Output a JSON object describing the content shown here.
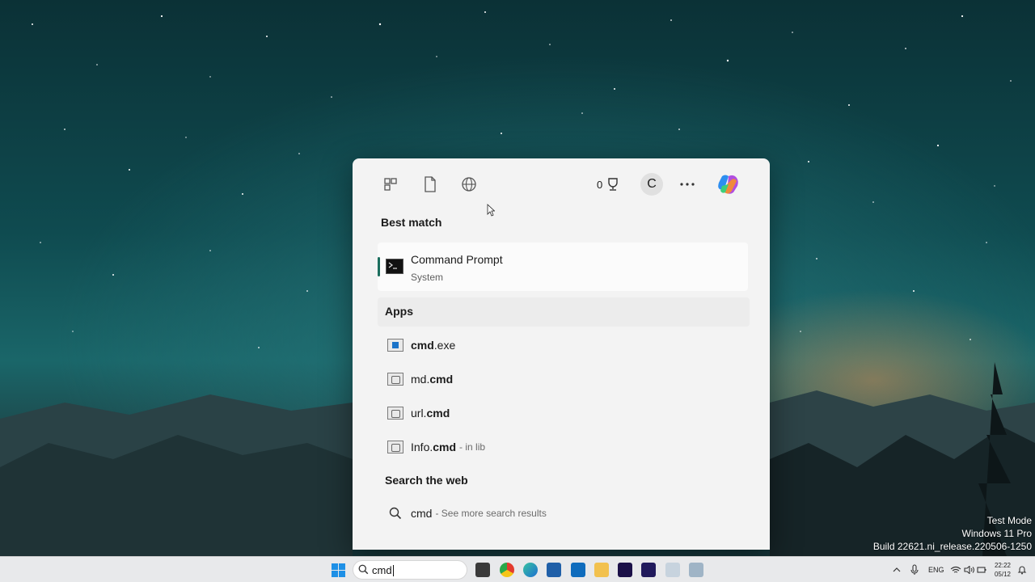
{
  "flyout": {
    "toolbar": {
      "points": "0",
      "avatar_letter": "C"
    },
    "best_match": {
      "title": "Best match",
      "item_name": "Command Prompt",
      "item_sub": "System"
    },
    "apps": {
      "title": "Apps",
      "items": [
        {
          "prefix": "",
          "bold": "cmd",
          "suffix": ".exe",
          "hint": ""
        },
        {
          "prefix": "md.",
          "bold": "cmd",
          "suffix": "",
          "hint": ""
        },
        {
          "prefix": "url.",
          "bold": "cmd",
          "suffix": "",
          "hint": ""
        },
        {
          "prefix": "Info.",
          "bold": "cmd",
          "suffix": "",
          "hint": "- in lib"
        }
      ]
    },
    "web": {
      "title": "Search the web",
      "query": "cmd",
      "hint": "- See more search results"
    }
  },
  "taskbar": {
    "search_value": "cmd",
    "tray_lang": "ENG",
    "clock_time": "22:22",
    "clock_date": "05/12"
  },
  "watermark": {
    "line1": "Test Mode",
    "line2": "Windows 11 Pro",
    "line3": "Build 22621.ni_release.220506-1250"
  },
  "colors": {
    "accent": "#1b6e5e",
    "panel": "#f3f3f3",
    "start_blue": "#1e90e6"
  }
}
